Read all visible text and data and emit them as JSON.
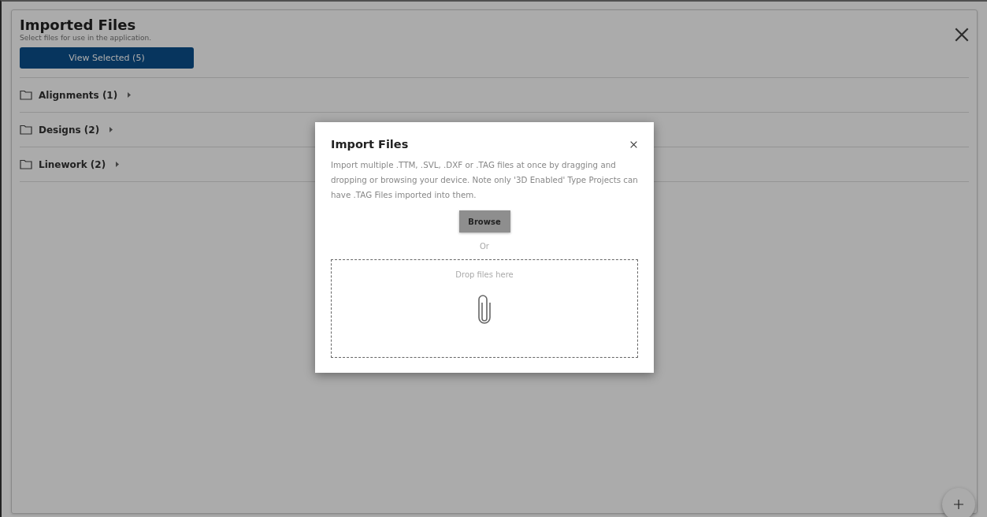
{
  "panel": {
    "title": "Imported Files",
    "subtitle": "Select files for use in the application.",
    "view_button": "View Selected (5)",
    "folders": [
      {
        "label": "Alignments (1)",
        "expanded": false
      },
      {
        "label": "Designs (2)",
        "expanded": false
      },
      {
        "label": "Linework (2)",
        "expanded": false
      }
    ]
  },
  "dialog": {
    "title": "Import Files",
    "description": "Import multiple .TTM, .SVL, .DXF or .TAG files at once by dragging and dropping or browsing your device. Note only '3D Enabled' Type Projects can have .TAG Files imported into them.",
    "browse_button": "Browse",
    "separator": "Or",
    "dropzone": {
      "placeholder": "Drop files here"
    }
  }
}
